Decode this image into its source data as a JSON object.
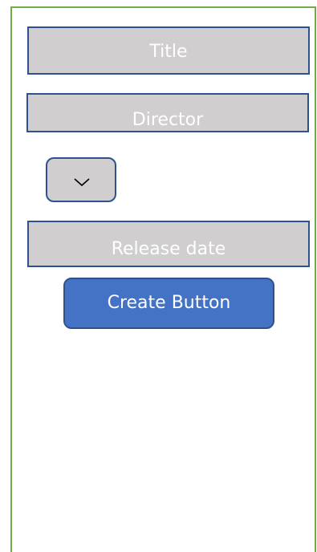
{
  "form": {
    "title_field": "Title",
    "director_field": "Director",
    "release_date_field": "Release date",
    "dropdown_icon": "chevron-down-icon",
    "create_button": "Create Button"
  },
  "colors": {
    "frame_border": "#70ad47",
    "field_fill": "#d0cece",
    "field_border": "#2f528f",
    "button_fill": "#4472c4",
    "text": "#ffffff"
  }
}
